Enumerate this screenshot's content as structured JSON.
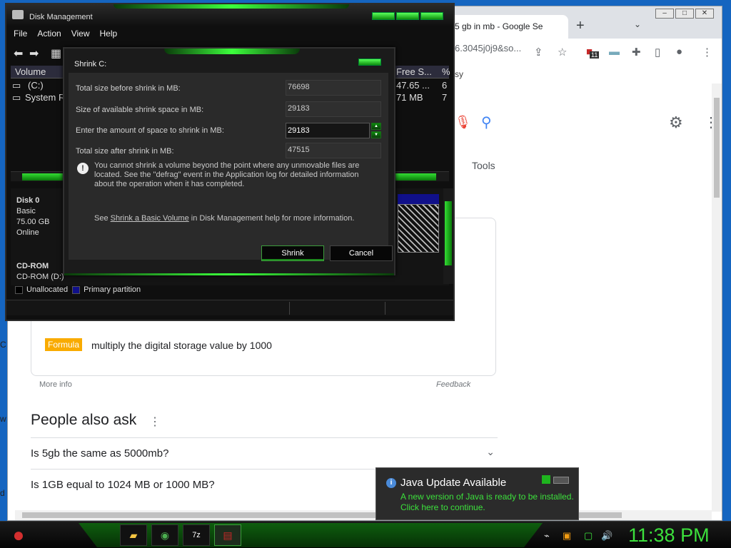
{
  "chrome": {
    "tab_title": "5 gb in mb - Google Se",
    "new_tab": "+",
    "url_fragment": "6.3045j0j9&so...",
    "extension_badge": "11",
    "bookmark_fragment": "sy",
    "window_buttons": [
      "‒",
      "□",
      "✕"
    ],
    "tools_label": "Tools",
    "formula_badge": "Formula",
    "formula_text": "multiply the digital storage value by 1000",
    "more_info": "More info",
    "feedback": "Feedback",
    "paa_title": "People also ask",
    "paa_questions": [
      "Is 5gb the same as 5000mb?",
      "Is 1GB equal to 1024 MB or 1000 MB?"
    ],
    "left_clip_chars": [
      "C",
      "w",
      "d"
    ]
  },
  "disk_management": {
    "title": "Disk Management",
    "menu": [
      "File",
      "Action",
      "View",
      "Help"
    ],
    "columns": {
      "volume": "Volume",
      "free_space": "Free S...",
      "pct": "%"
    },
    "rows": [
      {
        "volume": "(C:)",
        "free": "47.65 ...",
        "pct": "6"
      },
      {
        "volume": "System R",
        "free": "71 MB",
        "pct": "7"
      }
    ],
    "disks": [
      {
        "name": "Disk 0",
        "type": "Basic",
        "size": "75.00 GB",
        "status": "Online"
      },
      {
        "name": "CD-ROM",
        "type": "CD-ROM (D:)"
      }
    ],
    "legend": {
      "unallocated": "Unallocated",
      "primary": "Primary partition",
      "unallocated_color": "#000000",
      "primary_color": "#10108a"
    }
  },
  "shrink_dialog": {
    "title": "Shrink C:",
    "fields": [
      {
        "label": "Total size before shrink in MB:",
        "value": "76698"
      },
      {
        "label": "Size of available shrink space in MB:",
        "value": "29183"
      },
      {
        "label": "Enter the amount of space to shrink in MB:",
        "value": "29183"
      },
      {
        "label": "Total size after shrink in MB:",
        "value": "47515"
      }
    ],
    "info_text": "You cannot shrink a volume beyond the point where any unmovable files are located. See the \"defrag\" event in the Application log for detailed information about the operation when it has completed.",
    "help_prefix": "See ",
    "help_link": "Shrink a Basic Volume",
    "help_suffix": " in Disk Management help for more information.",
    "shrink_button": "Shrink",
    "cancel_button": "Cancel"
  },
  "java_notification": {
    "title": "Java Update Available",
    "line1": "A new version of Java is ready to be installed.",
    "line2": "Click here to continue."
  },
  "taskbar": {
    "clock": "11:38 PM",
    "app_7z_label": "7z",
    "accent_color": "#3ce03c"
  }
}
